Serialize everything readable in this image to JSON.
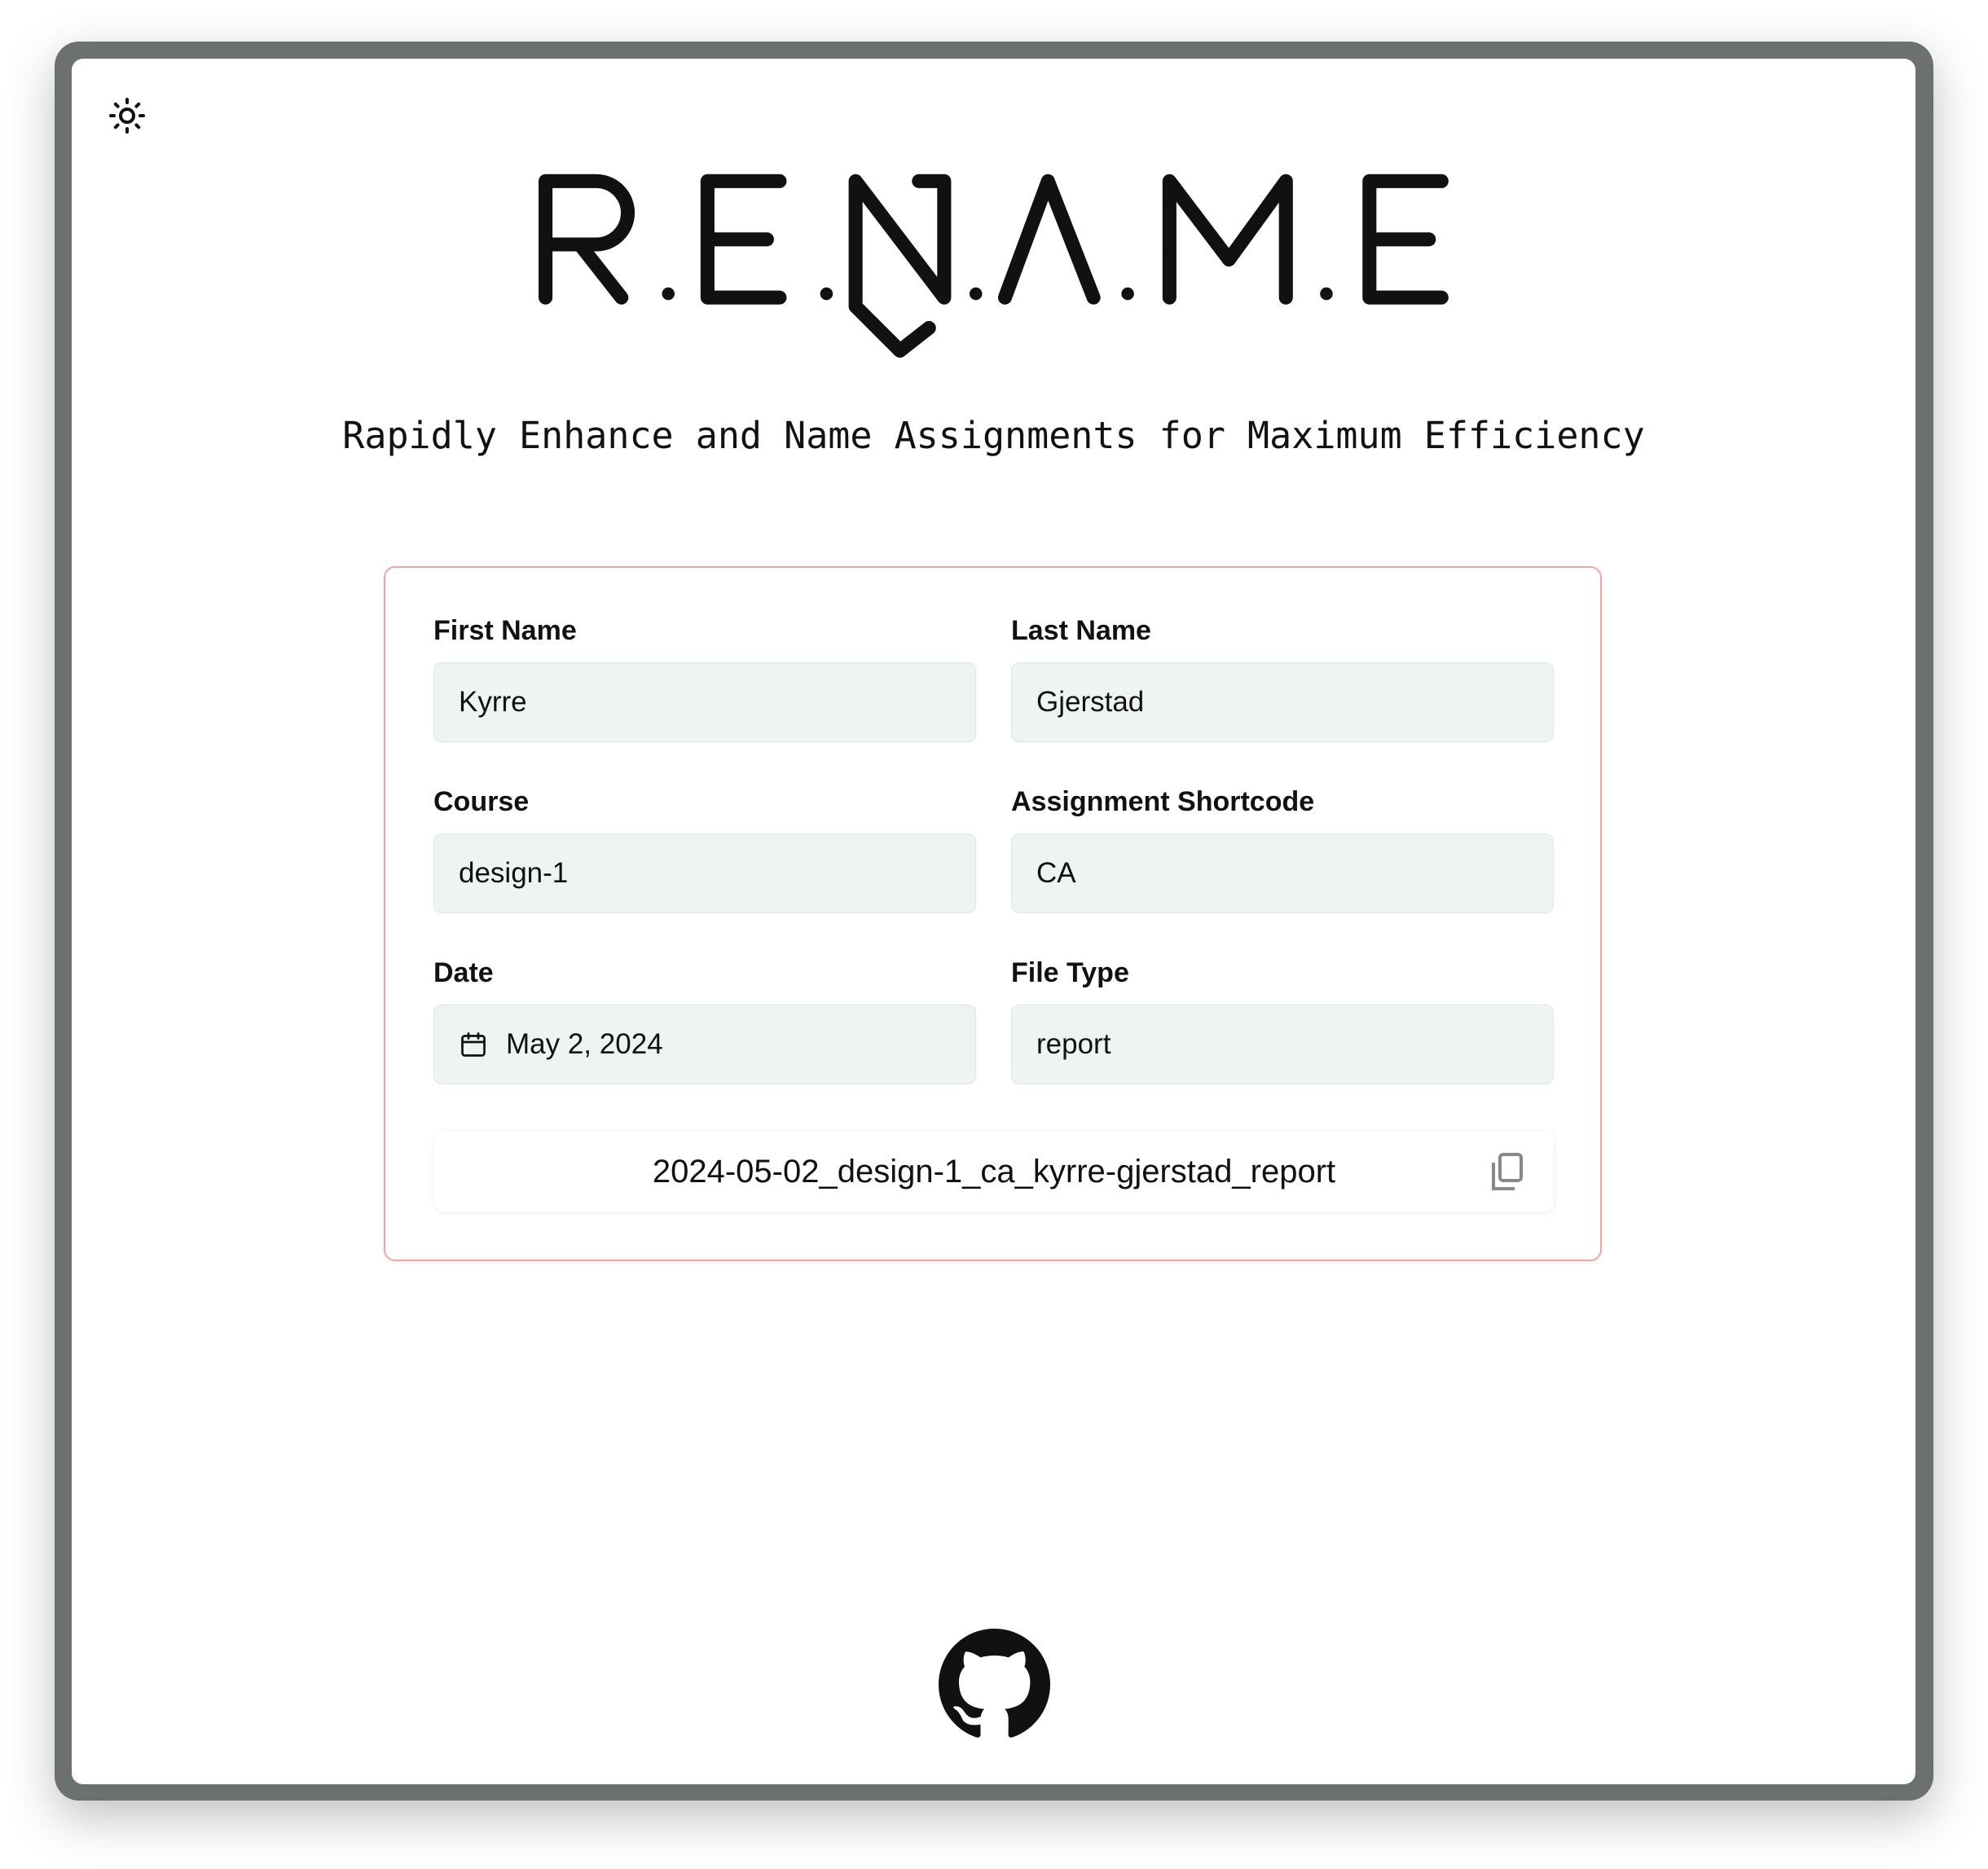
{
  "header": {
    "logo_text": "R.E.N.A.M.E",
    "subtitle": "Rapidly Enhance and Name Assignments for Maximum Efficiency",
    "theme_icon": "sun-icon"
  },
  "form": {
    "first_name": {
      "label": "First Name",
      "value": "Kyrre"
    },
    "last_name": {
      "label": "Last Name",
      "value": "Gjerstad"
    },
    "course": {
      "label": "Course",
      "value": "design-1"
    },
    "assignment": {
      "label": "Assignment Shortcode",
      "value": "CA"
    },
    "date": {
      "label": "Date",
      "value": "May 2, 2024",
      "icon": "calendar-icon"
    },
    "file_type": {
      "label": "File Type",
      "value": "report"
    }
  },
  "output": {
    "filename": "2024-05-02_design-1_ca_kyrre-gjerstad_report",
    "copy_icon": "copy-icon"
  },
  "footer": {
    "icon": "github-icon"
  },
  "colors": {
    "card_border": "#f2a59a",
    "input_bg": "#eef5f1",
    "frame": "#6c706f"
  }
}
